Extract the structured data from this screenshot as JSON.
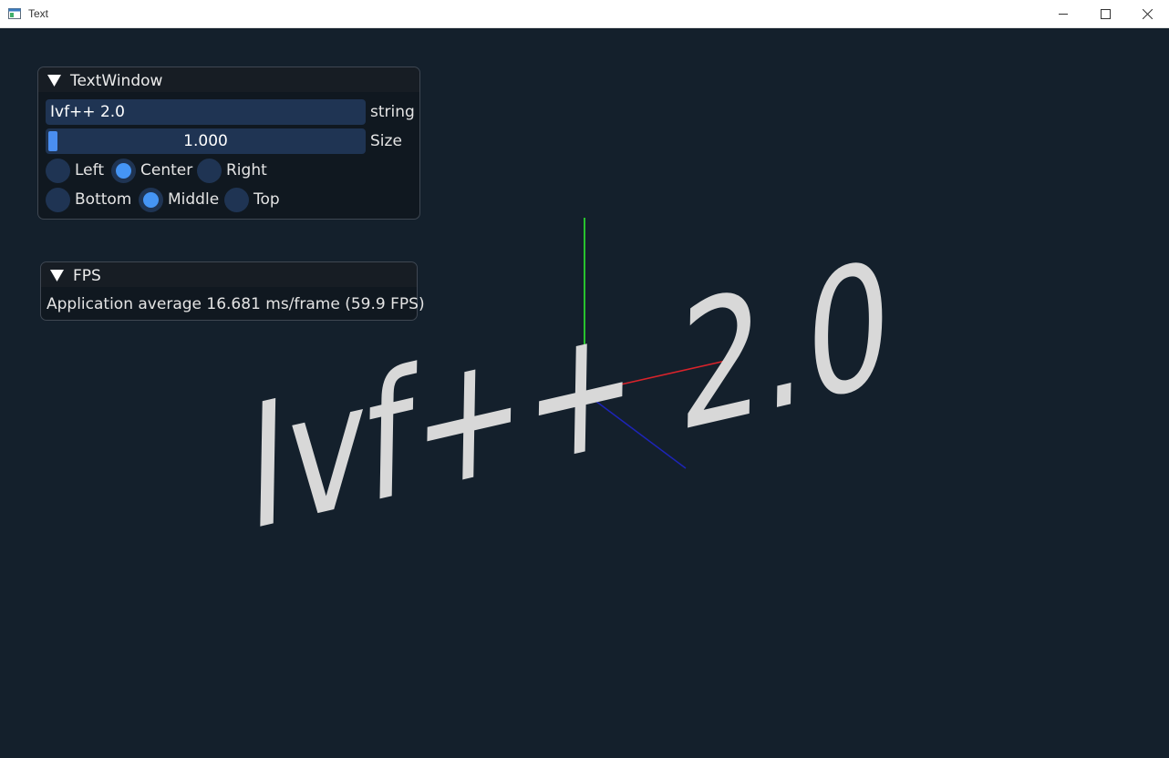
{
  "window": {
    "title": "Text"
  },
  "scene": {
    "text": "Ivf++ 2.0",
    "axis_colors": {
      "x": "#d9232b",
      "y": "#27c22e",
      "z": "#1d24b8"
    },
    "text_color": "#d8d8d8"
  },
  "text_window": {
    "title": "TextWindow",
    "string_value": "Ivf++ 2.0",
    "string_label": "string",
    "size_value": "1.000",
    "size_fraction": 0.02,
    "size_label": "Size",
    "halign": [
      {
        "label": "Left",
        "selected": false
      },
      {
        "label": "Center",
        "selected": true
      },
      {
        "label": "Right",
        "selected": false
      }
    ],
    "valign": [
      {
        "label": "Bottom",
        "selected": false
      },
      {
        "label": "Middle",
        "selected": true
      },
      {
        "label": "Top",
        "selected": false
      }
    ]
  },
  "fps_window": {
    "title": "FPS",
    "text": "Application average 16.681 ms/frame (59.9 FPS)"
  },
  "colors": {
    "accent": "#4595f5",
    "frame_bg": "#1f3453",
    "background": "#14202c"
  }
}
